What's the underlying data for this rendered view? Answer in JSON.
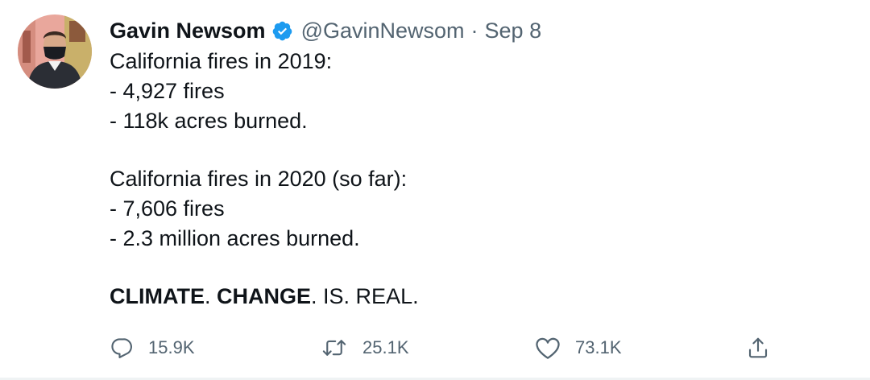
{
  "author": {
    "name": "Gavin Newsom",
    "handle": "@GavinNewsom",
    "separator": "·",
    "date": "Sep 8"
  },
  "tweet": {
    "lines": [
      "California fires in 2019:",
      "- 4,927 fires",
      "- 118k acres burned.",
      "",
      "California fires in 2020 (so far):",
      "- 7,606 fires",
      "- 2.3 million acres burned.",
      ""
    ],
    "closing": {
      "w1": "CLIMATE",
      "p1": ".",
      "w2": "CHANGE",
      "p2": ".",
      "rest": " IS. REAL."
    }
  },
  "actions": {
    "replies": "15.9K",
    "retweets": "25.1K",
    "likes": "73.1K"
  },
  "icons": {
    "verified": "verified-badge-icon",
    "reply": "reply-icon",
    "retweet": "retweet-icon",
    "like": "heart-icon",
    "share": "share-icon"
  },
  "colors": {
    "text": "#0f1419",
    "secondary": "#536471",
    "verified": "#1d9bf0"
  }
}
